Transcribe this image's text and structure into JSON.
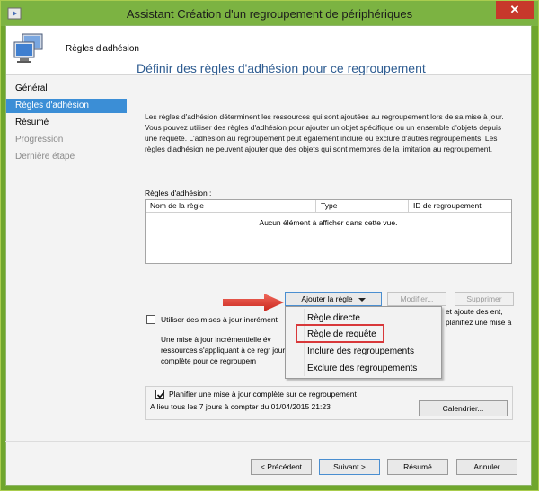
{
  "window": {
    "title": "Assistant Création d'un regroupement de périphériques",
    "close_glyph": "✕"
  },
  "header": {
    "title": "Règles d'adhésion"
  },
  "nav": {
    "items": [
      {
        "label": "Général",
        "state": "normal"
      },
      {
        "label": "Règles d'adhésion",
        "state": "active"
      },
      {
        "label": "Résumé",
        "state": "normal"
      },
      {
        "label": "Progression",
        "state": "disabled"
      },
      {
        "label": "Dernière étape",
        "state": "disabled"
      }
    ]
  },
  "main": {
    "title": "Définir des règles d'adhésion pour ce regroupement",
    "description": "Les règles d'adhésion déterminent les ressources qui sont ajoutées au regroupement lors de sa mise à jour. Vous pouvez utiliser des règles d'adhésion pour ajouter un objet spécifique ou un ensemble d'objets depuis une requête. L'adhésion au regroupement peut également inclure ou exclure d'autres regroupements. Les règles d'adhésion ne peuvent ajouter que des objets qui sont membres de la limitation au regroupement.",
    "rules_label": "Règles d'adhésion :",
    "table": {
      "columns": [
        "Nom de la règle",
        "Type",
        "ID de regroupement"
      ],
      "empty_message": "Aucun élément à afficher dans cette vue."
    },
    "buttons": {
      "add_rule": "Ajouter la règle",
      "modify": "Modifier...",
      "delete": "Supprimer"
    },
    "incremental": {
      "checkbox_label": "Utiliser des mises à jour incrément",
      "checked": false,
      "desc_left": "Une mise à jour incrémentielle év ressources s'appliquant à ce regr jour complète pour ce regroupem",
      "desc_right": "et ajoute des ent, planifiez une mise à"
    },
    "schedule": {
      "checkbox_label": "Planifier une mise à jour complète sur ce regroupement",
      "checked": true,
      "text": "A lieu tous les 7 jours à compter du 01/04/2015 21:23",
      "calendar_button": "Calendrier..."
    }
  },
  "dropdown_menu": {
    "items": [
      "Règle directe",
      "Règle de requête",
      "Inclure des regroupements",
      "Exclure des regroupements"
    ],
    "highlighted_index": 1,
    "highlight_color": "#d8383a"
  },
  "footer": {
    "prev": "< Précédent",
    "next": "Suivant >",
    "summary": "Résumé",
    "cancel": "Annuler"
  },
  "colors": {
    "title_bar": "#7cb342",
    "nav_active": "#3b8ed6",
    "heading": "#2e5c91",
    "close": "#c7382b"
  }
}
